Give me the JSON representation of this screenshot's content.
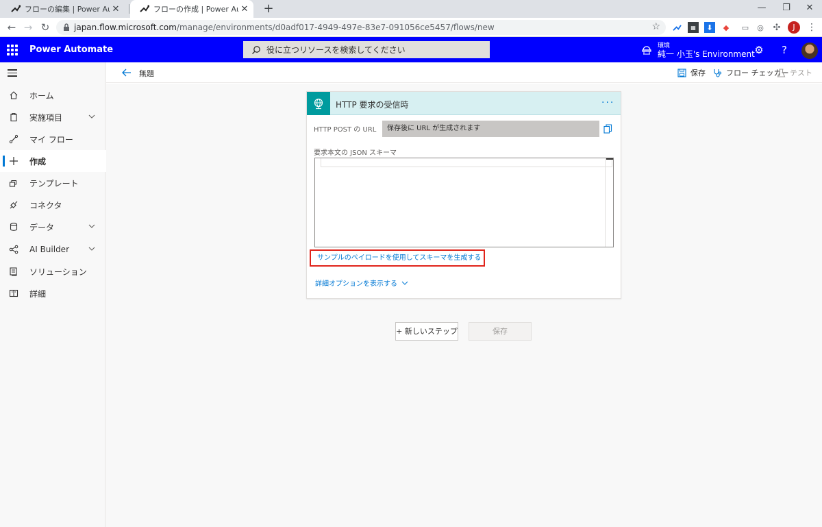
{
  "browser": {
    "tabs": [
      {
        "title": "フローの編集 | Power Automate",
        "close": "✕",
        "active": false
      },
      {
        "title": "フローの作成 | Power Automate",
        "close": "✕",
        "active": true
      }
    ],
    "new_tab": "+",
    "window_controls": {
      "minimize": "—",
      "restore": "❐",
      "close": "✕"
    },
    "url_host": "japan.flow.microsoft.com",
    "url_path": "/manage/environments/d0adf017-4949-497e-83e7-091056ce5457/flows/new",
    "profile_initial": "J"
  },
  "app": {
    "brand": "Power Automate",
    "search_placeholder": "役に立つリソースを検索してください",
    "env_label": "環境",
    "env_name": "純一 小玉's Environment",
    "help": "?"
  },
  "nav": {
    "items": [
      {
        "label": "ホーム",
        "icon": "home-icon",
        "expandable": false
      },
      {
        "label": "実施項目",
        "icon": "clipboard-icon",
        "expandable": true
      },
      {
        "label": "マイ フロー",
        "icon": "flow-icon",
        "expandable": false
      },
      {
        "label": "作成",
        "icon": "plus-icon",
        "expandable": false,
        "active": true
      },
      {
        "label": "テンプレート",
        "icon": "template-icon",
        "expandable": false
      },
      {
        "label": "コネクタ",
        "icon": "connector-icon",
        "expandable": false
      },
      {
        "label": "データ",
        "icon": "database-icon",
        "expandable": true
      },
      {
        "label": "AI Builder",
        "icon": "ai-builder-icon",
        "expandable": true
      },
      {
        "label": "ソリューション",
        "icon": "solution-icon",
        "expandable": false
      },
      {
        "label": "詳細",
        "icon": "book-icon",
        "expandable": false
      }
    ]
  },
  "command_bar": {
    "flow_name": "無題",
    "save": "保存",
    "flow_checker": "フロー チェッカー",
    "test": "テスト"
  },
  "trigger_card": {
    "title": "HTTP 要求の受信時",
    "more": "···",
    "url_label": "HTTP POST の URL",
    "url_value": "保存後に URL が生成されます",
    "schema_label": "要求本文の JSON スキーマ",
    "schema_value": "",
    "sample_link": "サンプルのペイロードを使用してスキーマを生成する",
    "advanced_link": "詳細オプションを表示する"
  },
  "footer_buttons": {
    "new_step": "+ 新しいステップ",
    "save": "保存"
  },
  "colors": {
    "header_bg": "#0000ff",
    "accent": "#0078d4",
    "trigger_icon_bg": "#009b9e",
    "trigger_header_bg": "#d7f0f2",
    "highlight_border": "#e0231a"
  }
}
